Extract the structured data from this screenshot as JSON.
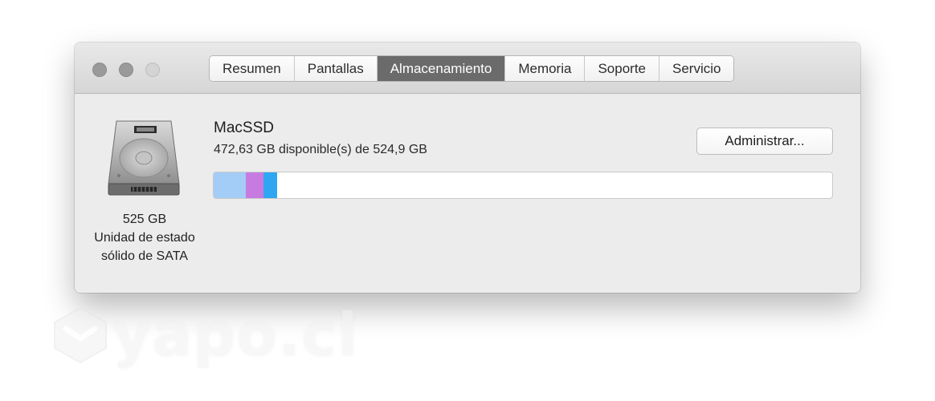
{
  "window": {
    "tabs": [
      {
        "label": "Resumen"
      },
      {
        "label": "Pantallas"
      },
      {
        "label": "Almacenamiento"
      },
      {
        "label": "Memoria"
      },
      {
        "label": "Soporte"
      },
      {
        "label": "Servicio"
      }
    ],
    "active_tab": "Almacenamiento"
  },
  "drive": {
    "icon": "hard-drive-icon",
    "capacity": "525 GB",
    "type_line1": "Unidad de estado",
    "type_line2": "sólido de SATA"
  },
  "volume": {
    "name": "MacSSD",
    "detail": "472,63 GB disponible(s) de 524,9 GB",
    "manage_label": "Administrar...",
    "usage_segments": [
      {
        "category": "segment-1",
        "fraction": 0.052,
        "color": "#a3cdf7"
      },
      {
        "category": "segment-2",
        "fraction": 0.029,
        "color": "#c77be0"
      },
      {
        "category": "segment-3",
        "fraction": 0.022,
        "color": "#2fa6f2"
      }
    ]
  },
  "watermark": {
    "text": "yapo.cl"
  },
  "colors": {
    "active_tab_bg": "#6b6b6b",
    "window_bg": "#ececec"
  }
}
